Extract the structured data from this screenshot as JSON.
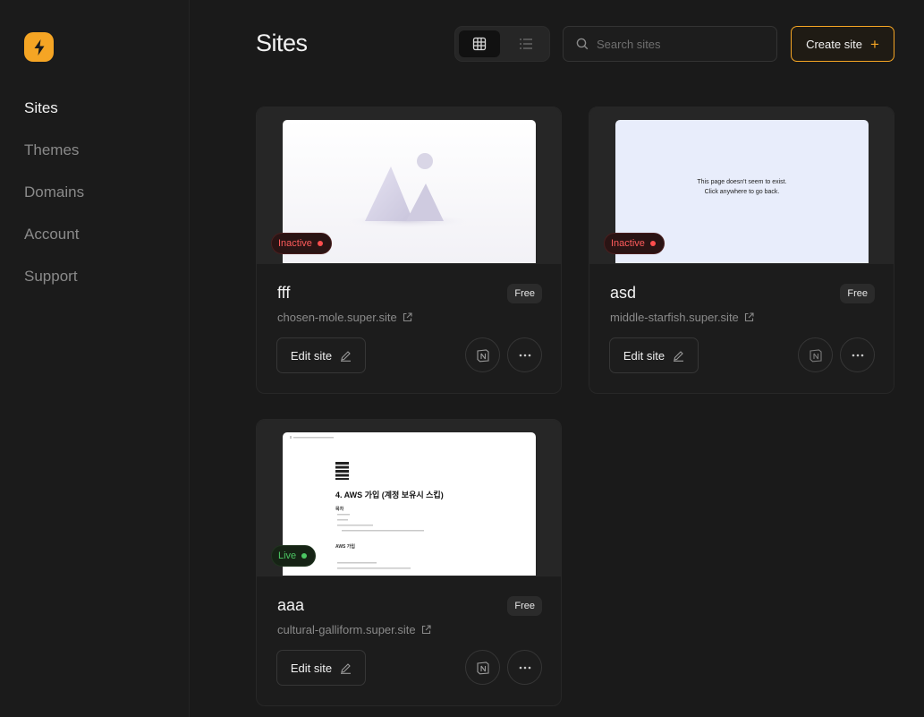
{
  "app": {
    "accent": "#f5a524"
  },
  "sidebar": {
    "logo_icon": "lightning-bolt-icon",
    "items": [
      {
        "label": "Sites",
        "active": true
      },
      {
        "label": "Themes",
        "active": false
      },
      {
        "label": "Domains",
        "active": false
      },
      {
        "label": "Account",
        "active": false
      },
      {
        "label": "Support",
        "active": false
      }
    ]
  },
  "header": {
    "title": "Sites",
    "view_toggle": {
      "selected": "grid",
      "options": [
        "grid-view-icon",
        "list-view-icon"
      ]
    },
    "search": {
      "placeholder": "Search sites",
      "value": ""
    },
    "create_label": "Create site",
    "create_icon": "plus-icon"
  },
  "sites": [
    {
      "name": "fff",
      "status": "Inactive",
      "status_color": "#ff4d4d",
      "plan": "Free",
      "url": "chosen-mole.super.site",
      "edit_label": "Edit site",
      "preview": "placeholder-image"
    },
    {
      "name": "asd",
      "status": "Inactive",
      "status_color": "#ff4d4d",
      "plan": "Free",
      "url": "middle-starfish.super.site",
      "edit_label": "Edit site",
      "preview": "not-found-page",
      "preview_text": [
        "This page doesn't seem to exist.",
        "Click anywhere to go back."
      ]
    },
    {
      "name": "aaa",
      "status": "Live",
      "status_color": "#4cc763",
      "plan": "Free",
      "url": "cultural-galliform.super.site",
      "edit_label": "Edit site",
      "preview": "notion-document",
      "preview_doc": {
        "title": "4. AWS 가입 (계정 보유시 스킵)",
        "section_1": "목차",
        "section_2": "AWS 가입"
      }
    }
  ]
}
